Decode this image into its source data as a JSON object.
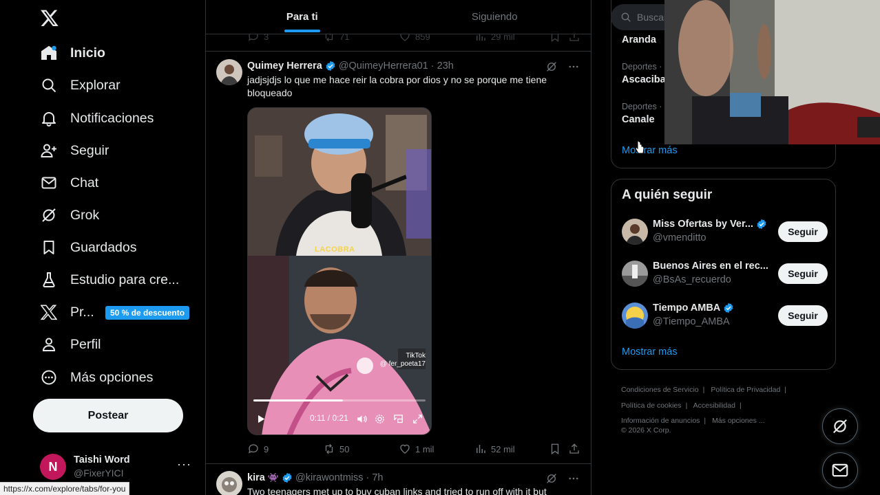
{
  "nav": {
    "items": [
      {
        "label": "Inicio",
        "icon": "home-icon"
      },
      {
        "label": "Explorar",
        "icon": "search-icon"
      },
      {
        "label": "Notificaciones",
        "icon": "bell-icon"
      },
      {
        "label": "Seguir",
        "icon": "add-person-icon"
      },
      {
        "label": "Chat",
        "icon": "mail-icon"
      },
      {
        "label": "Grok",
        "icon": "grok-icon"
      },
      {
        "label": "Guardados",
        "icon": "bookmark-icon"
      },
      {
        "label": "Estudio para cre...",
        "icon": "creator-studio-icon"
      },
      {
        "label": "Pr...",
        "icon": "x-premium-icon"
      },
      {
        "label": "Perfil",
        "icon": "profile-icon"
      },
      {
        "label": "Más opciones",
        "icon": "more-circle-icon"
      }
    ],
    "premium_badge": "50 % de descuento",
    "post_button": "Postear",
    "account": {
      "initial": "N",
      "name": "Taishi Word",
      "handle": "@FixerYICI",
      "more": "···"
    }
  },
  "status_url": "https://x.com/explore/tabs/for-you",
  "timeline": {
    "tabs": [
      {
        "label": "Para ti",
        "active": true
      },
      {
        "label": "Siguiendo",
        "active": false
      }
    ],
    "prev_stats": {
      "replies": "3",
      "reposts": "71",
      "likes": "859",
      "views": "29 mil"
    },
    "tweets": [
      {
        "name": "Quimey Herrera",
        "handle": "@QuimeyHerrera01",
        "time": "· 23h",
        "text": "jadjsjdjs lo que me hace reir la cobra por dios y no se porque me tiene bloqueado",
        "video": {
          "caption": "LACOBRA",
          "watermark": "TikTok",
          "watermark_user": "@ fer_poeta17",
          "time": "0:11 / 0:21",
          "progress": 0.52
        },
        "stats": {
          "replies": "9",
          "reposts": "50",
          "likes": "1 mil",
          "views": "52 mil"
        }
      },
      {
        "name": "kira",
        "emoji": "👾",
        "handle": "@kirawontmiss",
        "time": "· 7h",
        "text": "Two teenagers met up to buy cuban links and tried to run off with it but"
      }
    ]
  },
  "right": {
    "search_placeholder": "Buscar",
    "trends": [
      {
        "category": "",
        "name": "Aranda"
      },
      {
        "category": "Deportes ·",
        "name": "Ascaciba"
      },
      {
        "category": "Deportes ·",
        "name": "Canale"
      }
    ],
    "trends_more": "Mostrar más",
    "who_to_follow": {
      "title": "A quién seguir",
      "accounts": [
        {
          "name": "Miss Ofertas by Ver...",
          "handle": "@vmenditto",
          "verified": true,
          "button": "Seguir"
        },
        {
          "name": "Buenos Aires en el rec...",
          "handle": "@BsAs_recuerdo",
          "verified": false,
          "button": "Seguir"
        },
        {
          "name": "Tiempo AMBA",
          "handle": "@Tiempo_AMBA",
          "verified": true,
          "button": "Seguir"
        }
      ],
      "more": "Mostrar más"
    },
    "footer": {
      "links": [
        "Condiciones de Servicio",
        "Política de Privacidad",
        "Política de cookies",
        "Accesibilidad",
        "Información de anuncios",
        "Más opciones ..."
      ],
      "copyright": "© 2026 X Corp."
    }
  },
  "colors": {
    "accent": "#1d9bf0",
    "background": "#000000",
    "text": "#e7e9ea",
    "muted": "#71767b",
    "border": "#2f3336"
  }
}
